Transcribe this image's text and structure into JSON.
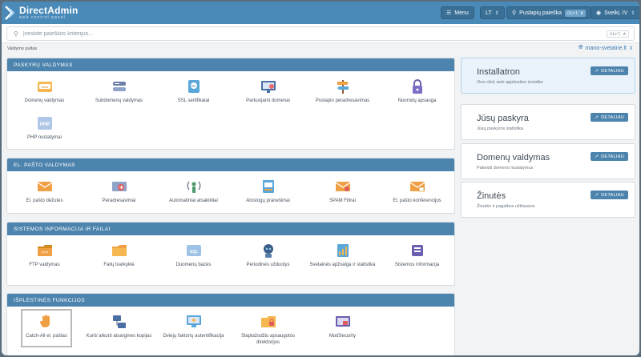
{
  "header": {
    "brand": "DirectAdmin",
    "tagline": "web control panel",
    "menu_label": "Menu",
    "lang_label": "LT",
    "page_search_label": "Puslapių paieška",
    "page_search_kbd": "Ctrl K",
    "greeting": "Sveiki, IV"
  },
  "search": {
    "placeholder": "Įveskite paieškos kriterijus...",
    "kbd": "Ctrl A"
  },
  "breadcrumb": "Valdymo pultas",
  "domain_selector": "mano-svetaine.lt",
  "sections": [
    {
      "title": "PASKYRŲ VALDYMAS",
      "items": [
        {
          "label": "Domenų valdymas",
          "icon": "www-icon"
        },
        {
          "label": "Subdomenų valdymas",
          "icon": "subdomain-icon"
        },
        {
          "label": "SSL sertifikatai",
          "icon": "ssl-icon"
        },
        {
          "label": "Parkuojami domenai",
          "icon": "parked-domain-icon"
        },
        {
          "label": "Puslapio peradresavimas",
          "icon": "signpost-icon"
        },
        {
          "label": "Nuorodų apsauga",
          "icon": "lock-icon"
        },
        {
          "label": "PHP nustatymai",
          "icon": "php-icon"
        }
      ]
    },
    {
      "title": "EL. PAŠTO VALDYMAS",
      "items": [
        {
          "label": "El. pašto dėžutės",
          "icon": "mailbox-icon"
        },
        {
          "label": "Peradresavimai",
          "icon": "forward-icon"
        },
        {
          "label": "Automatiniai atsakikliai",
          "icon": "autoresponder-icon"
        },
        {
          "label": "Atostogų pranešimai",
          "icon": "vacation-icon"
        },
        {
          "label": "SPAM Filtrai",
          "icon": "spam-filter-icon"
        },
        {
          "label": "El. pašto konferencijos",
          "icon": "mailing-list-icon"
        }
      ]
    },
    {
      "title": "SISTEMOS INFORMACIJA IR FAILAI",
      "items": [
        {
          "label": "FTP valdymas",
          "icon": "ftp-icon"
        },
        {
          "label": "Failų tvarkyklė",
          "icon": "folder-icon"
        },
        {
          "label": "Duomenų bazės",
          "icon": "sql-database-icon"
        },
        {
          "label": "Periodinės užduotys",
          "icon": "cron-robot-icon"
        },
        {
          "label": "Svetainės apžvalga ir statistika",
          "icon": "statistics-icon"
        },
        {
          "label": "Sistemos informacija",
          "icon": "system-info-icon"
        }
      ]
    },
    {
      "title": "IŠPLĖSTINĖS FUNKCIJOS",
      "items": [
        {
          "label": "Catch-All el. paštas",
          "icon": "catch-all-icon"
        },
        {
          "label": "Kurti/ atkurti atsargines kopijas",
          "icon": "backup-icon"
        },
        {
          "label": "Dviejų faktorių autentifikacija",
          "icon": "two-factor-icon"
        },
        {
          "label": "Slaptažodžiu apsaugotos direktorijos",
          "icon": "protected-dir-icon"
        },
        {
          "label": "ModSecurity",
          "icon": "modsecurity-icon"
        }
      ]
    }
  ],
  "cards": [
    {
      "title": "Installatron",
      "subtitle": "One-click web application installer",
      "button": "DETALIAU"
    },
    {
      "title": "Jūsų paskyra",
      "subtitle": "Jūsų paskyros statistika",
      "button": "DETALIAU"
    },
    {
      "title": "Domenų valdymas",
      "subtitle": "Pakeisti domeno nustatymus",
      "button": "DETALIAU"
    },
    {
      "title": "Žinutės",
      "subtitle": "Žinutės ir pagalbos užklausos",
      "button": "DETALIAU"
    }
  ],
  "colors": {
    "topbar": "#4a8ab8",
    "section_header": "#4d84ad",
    "accent_orange": "#f0a044"
  }
}
